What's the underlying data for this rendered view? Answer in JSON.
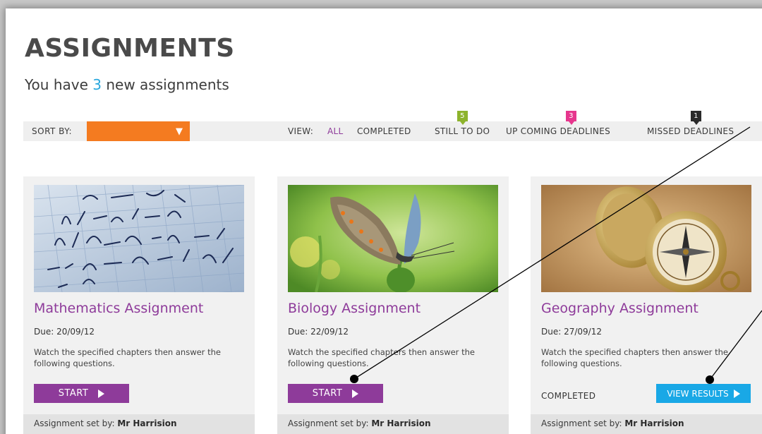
{
  "header": {
    "title": "ASSIGNMENTS",
    "subtitle_prefix": "You have ",
    "subtitle_count": "3",
    "subtitle_suffix": " new assignments"
  },
  "toolbar": {
    "sort_label": "SORT BY:",
    "sort_value": "",
    "sort_arrow": "▼",
    "view_label": "VIEW:",
    "filters": [
      {
        "label": "ALL",
        "active": true
      },
      {
        "label": "COMPLETED",
        "active": false
      },
      {
        "label": "STILL TO DO",
        "badge": "5",
        "badge_color": "#8db32c"
      },
      {
        "label": "UP COMING DEADLINES",
        "badge": "3",
        "badge_color": "#e6368d"
      },
      {
        "label": "MISSED DEADLINES",
        "badge": "1",
        "badge_color": "#2b2b2b"
      }
    ]
  },
  "cards": [
    {
      "title": "Mathematics Assignment",
      "due": "Due: 20/09/12",
      "description": "Watch the specified chapters then answer the following questions.",
      "action": "START",
      "set_by_prefix": "Assignment set by: ",
      "set_by_name": "Mr Harrision",
      "image": "math-formulas-image"
    },
    {
      "title": "Biology Assignment",
      "due": "Due: 22/09/12",
      "description": "Watch the specified chapters then answer the following questions.",
      "action": "START",
      "set_by_prefix": "Assignment set by: ",
      "set_by_name": "Mr Harrision",
      "image": "butterfly-image"
    },
    {
      "title": "Geography Assignment",
      "due": "Due: 27/09/12",
      "description": "Watch the specified chapters then answer the following questions.",
      "status": "COMPLETED",
      "action": "VIEW RESULTS",
      "set_by_prefix": "Assignment set by: ",
      "set_by_name": "Mr Harrision",
      "image": "compass-image"
    }
  ],
  "colors": {
    "accent_purple": "#8e3b9a",
    "accent_blue": "#19a8e6",
    "sort_orange": "#f47b20"
  }
}
